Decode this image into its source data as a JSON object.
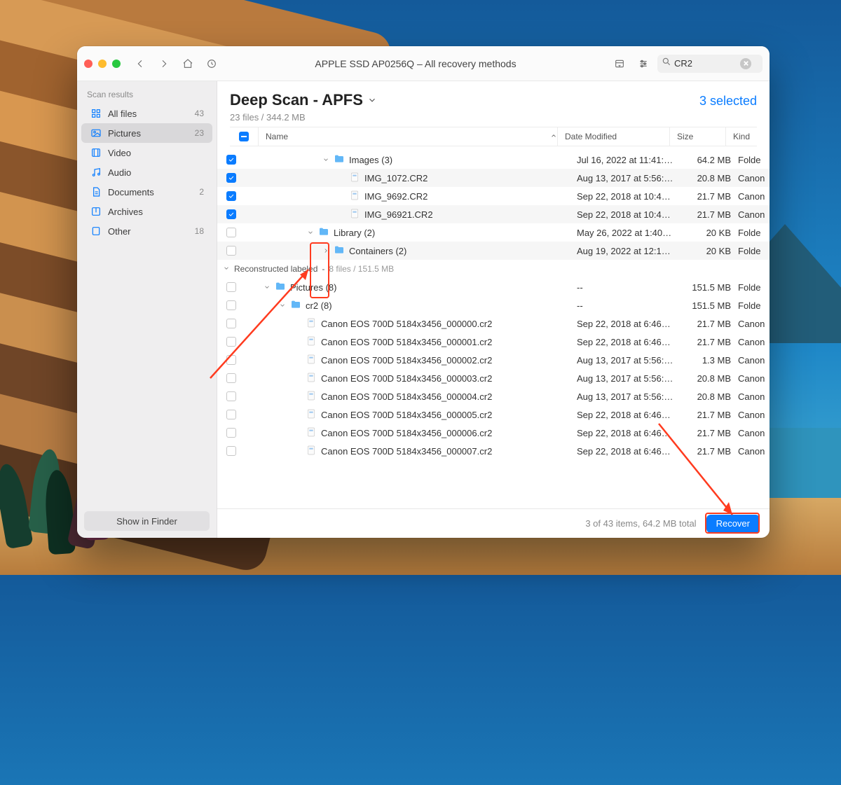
{
  "toolbar": {
    "title": "APPLE SSD AP0256Q – All recovery methods",
    "search_value": "CR2"
  },
  "sidebar": {
    "header": "Scan results",
    "items": [
      {
        "icon": "grid",
        "label": "All files",
        "count": "43"
      },
      {
        "icon": "image",
        "label": "Pictures",
        "count": "23",
        "selected": true
      },
      {
        "icon": "film",
        "label": "Video",
        "count": ""
      },
      {
        "icon": "music",
        "label": "Audio",
        "count": ""
      },
      {
        "icon": "doc",
        "label": "Documents",
        "count": "2"
      },
      {
        "icon": "archive",
        "label": "Archives",
        "count": ""
      },
      {
        "icon": "other",
        "label": "Other",
        "count": "18"
      }
    ],
    "show_in_finder": "Show in Finder"
  },
  "header": {
    "title": "Deep Scan - APFS",
    "subtitle": "23 files / 344.2 MB",
    "selected_text": "3 selected"
  },
  "columns": {
    "name": "Name",
    "date": "Date Modified",
    "size": "Size",
    "kind": "Kind"
  },
  "rows": [
    {
      "checked": true,
      "indent": 2,
      "disclosure": "down",
      "icon": "folder",
      "name": "Images (3)",
      "date": "Jul 16, 2022 at 11:41:…",
      "size": "64.2 MB",
      "kind": "Folde"
    },
    {
      "checked": true,
      "indent": 3,
      "disclosure": "",
      "icon": "file",
      "name": "IMG_1072.CR2",
      "date": "Aug 13, 2017 at 5:56:…",
      "size": "20.8 MB",
      "kind": "Canon"
    },
    {
      "checked": true,
      "indent": 3,
      "disclosure": "",
      "icon": "file",
      "name": "IMG_9692.CR2",
      "date": "Sep 22, 2018 at 10:4…",
      "size": "21.7 MB",
      "kind": "Canon"
    },
    {
      "checked": true,
      "indent": 3,
      "disclosure": "",
      "icon": "file",
      "name": "IMG_96921.CR2",
      "date": "Sep 22, 2018 at 10:4…",
      "size": "21.7 MB",
      "kind": "Canon"
    },
    {
      "checked": false,
      "indent": 1,
      "disclosure": "down",
      "icon": "folder",
      "name": "Library (2)",
      "date": "May 26, 2022 at 1:40…",
      "size": "20 KB",
      "kind": "Folde"
    },
    {
      "checked": false,
      "indent": 2,
      "disclosure": "right",
      "icon": "folder",
      "name": "Containers (2)",
      "date": "Aug 19, 2022 at 12:1…",
      "size": "20 KB",
      "kind": "Folde"
    }
  ],
  "group2": {
    "title": "Reconstructed labeled",
    "meta": "8 files / 151.5 MB"
  },
  "rows2": [
    {
      "checked": false,
      "indent": 0,
      "disclosure": "down",
      "icon": "folder",
      "name": "Pictures (8)",
      "date": "--",
      "size": "151.5 MB",
      "kind": "Folde"
    },
    {
      "checked": false,
      "indent": 1,
      "disclosure": "down",
      "icon": "folder",
      "name": "cr2 (8)",
      "date": "--",
      "size": "151.5 MB",
      "kind": "Folde"
    },
    {
      "checked": false,
      "indent": 2,
      "disclosure": "",
      "icon": "file",
      "name": "Canon EOS 700D 5184x3456_000000.cr2",
      "date": "Sep 22, 2018 at 6:46…",
      "size": "21.7 MB",
      "kind": "Canon"
    },
    {
      "checked": false,
      "indent": 2,
      "disclosure": "",
      "icon": "file",
      "name": "Canon EOS 700D 5184x3456_000001.cr2",
      "date": "Sep 22, 2018 at 6:46…",
      "size": "21.7 MB",
      "kind": "Canon"
    },
    {
      "checked": false,
      "indent": 2,
      "disclosure": "",
      "icon": "file",
      "name": "Canon EOS 700D 5184x3456_000002.cr2",
      "date": "Aug 13, 2017 at 5:56:…",
      "size": "1.3 MB",
      "kind": "Canon"
    },
    {
      "checked": false,
      "indent": 2,
      "disclosure": "",
      "icon": "file",
      "name": "Canon EOS 700D 5184x3456_000003.cr2",
      "date": "Aug 13, 2017 at 5:56:…",
      "size": "20.8 MB",
      "kind": "Canon"
    },
    {
      "checked": false,
      "indent": 2,
      "disclosure": "",
      "icon": "file",
      "name": "Canon EOS 700D 5184x3456_000004.cr2",
      "date": "Aug 13, 2017 at 5:56:…",
      "size": "20.8 MB",
      "kind": "Canon"
    },
    {
      "checked": false,
      "indent": 2,
      "disclosure": "",
      "icon": "file",
      "name": "Canon EOS 700D 5184x3456_000005.cr2",
      "date": "Sep 22, 2018 at 6:46…",
      "size": "21.7 MB",
      "kind": "Canon"
    },
    {
      "checked": false,
      "indent": 2,
      "disclosure": "",
      "icon": "file",
      "name": "Canon EOS 700D 5184x3456_000006.cr2",
      "date": "Sep 22, 2018 at 6:46…",
      "size": "21.7 MB",
      "kind": "Canon"
    },
    {
      "checked": false,
      "indent": 2,
      "disclosure": "",
      "icon": "file",
      "name": "Canon EOS 700D 5184x3456_000007.cr2",
      "date": "Sep 22, 2018 at 6:46…",
      "size": "21.7 MB",
      "kind": "Canon"
    }
  ],
  "footer": {
    "summary": "3 of 43 items, 64.2 MB total",
    "recover": "Recover"
  }
}
